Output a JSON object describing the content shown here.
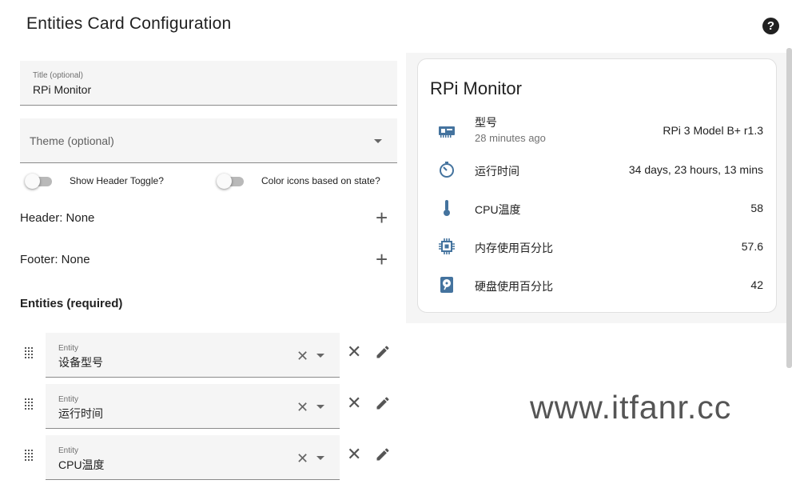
{
  "dialog": {
    "title": "Entities Card Configuration",
    "help_icon": "help-circle-icon"
  },
  "form": {
    "title_field": {
      "label": "Title (optional)",
      "value": "RPi Monitor"
    },
    "theme_field": {
      "label": "Theme (optional)",
      "value": ""
    },
    "toggles": [
      {
        "label": "Show Header Toggle?",
        "on": false
      },
      {
        "label": "Color icons based on state?",
        "on": false
      }
    ],
    "header": {
      "label": "Header: None"
    },
    "footer": {
      "label": "Footer: None"
    },
    "entities_title": "Entities (required)",
    "entity_label": "Entity",
    "entities": [
      {
        "value": "设备型号"
      },
      {
        "value": "运行时间"
      },
      {
        "value": "CPU温度"
      }
    ]
  },
  "preview": {
    "card_title": "RPi Monitor",
    "rows": [
      {
        "name": "型号",
        "secondary": "28 minutes ago",
        "state": "RPi 3 Model B+ r1.3",
        "icon": "expansion-card-icon"
      },
      {
        "name": "运行时间",
        "state": "34 days, 23 hours, 13 mins",
        "icon": "timer-icon"
      },
      {
        "name": "CPU温度",
        "state": "58",
        "icon": "thermometer-icon"
      },
      {
        "name": "内存使用百分比",
        "state": "57.6",
        "icon": "memory-chip-icon"
      },
      {
        "name": "硬盘使用百分比",
        "state": "42",
        "icon": "harddisk-icon"
      }
    ],
    "icon_color": "#44739e"
  },
  "watermark": "www.itfanr.cc"
}
